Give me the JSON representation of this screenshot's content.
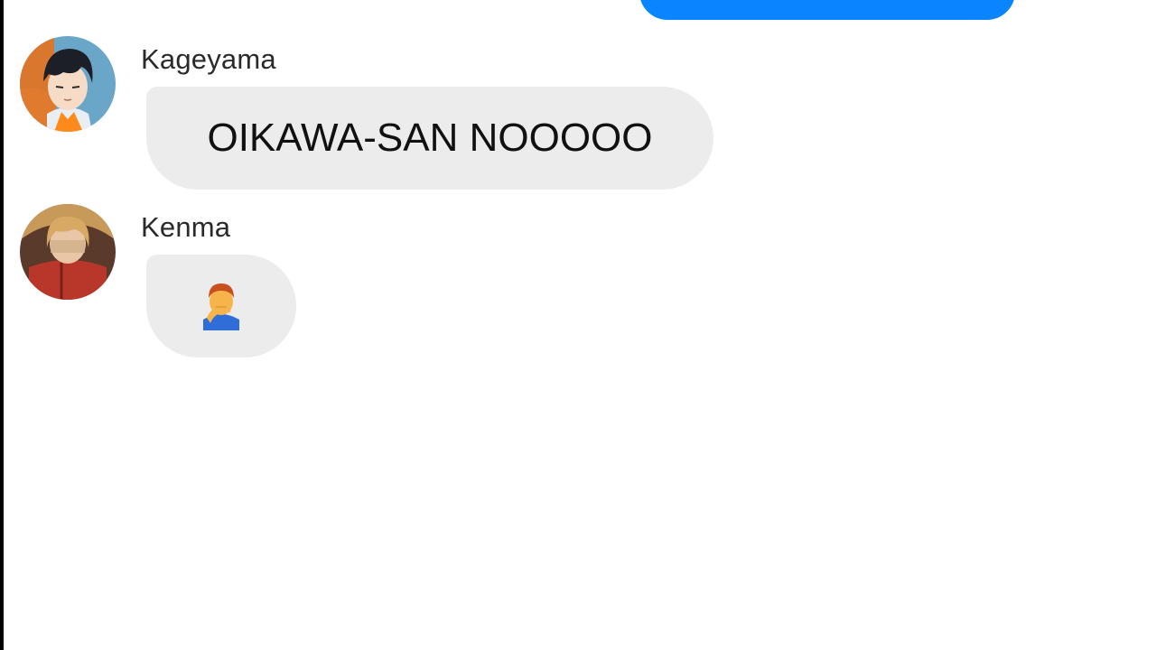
{
  "conversation": {
    "messages": [
      {
        "sender": "Kageyama",
        "text": "OIKAWA-SAN NOOOOO",
        "avatar_icon": "anime-avatar-icon"
      },
      {
        "sender": "Kenma",
        "text": "",
        "emoji_icon": "man-facepalming-emoji-icon",
        "avatar_icon": "anime-avatar-icon"
      }
    ]
  },
  "colors": {
    "outgoing_bubble": "#0a84ff",
    "incoming_bubble": "#ececec",
    "background": "#ffffff"
  }
}
